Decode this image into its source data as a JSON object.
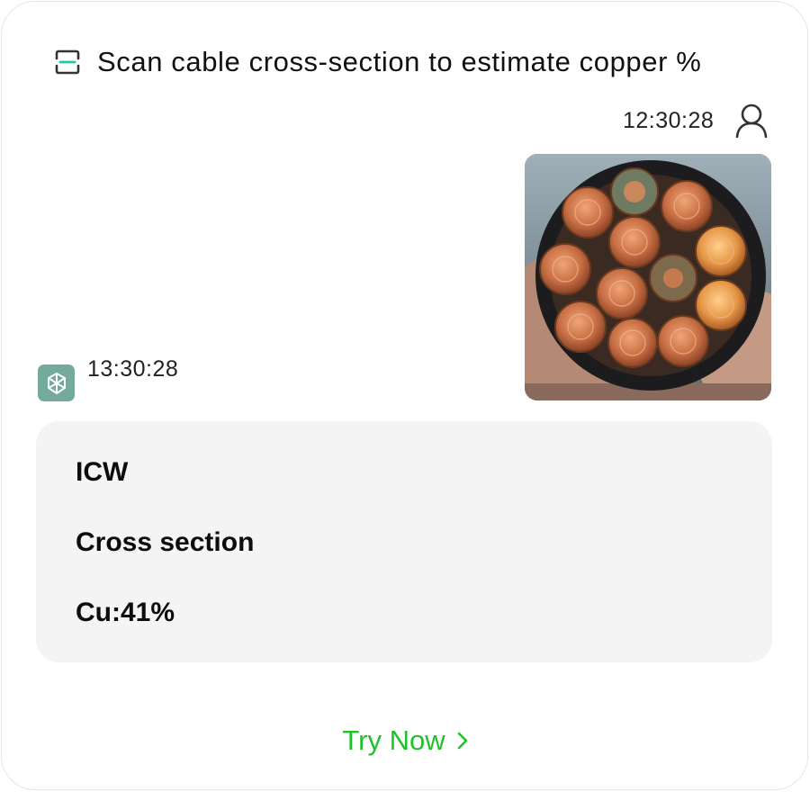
{
  "header": {
    "title": "Scan cable cross-section to estimate copper %",
    "icon": "scan-icon",
    "accent_color": "#21c5a8"
  },
  "user_message": {
    "timestamp": "12:30:28",
    "avatar_icon": "user-icon",
    "attachment": "cable-cross-section-photo"
  },
  "bot_message": {
    "timestamp": "13:30:28",
    "avatar_icon": "chatgpt-logo-icon",
    "avatar_color": "#74aa9c",
    "lines": [
      "ICW",
      "Cross section",
      "Cu:41%"
    ]
  },
  "cta": {
    "label": "Try Now",
    "icon": "chevron-right-icon",
    "color": "#21c12c"
  }
}
